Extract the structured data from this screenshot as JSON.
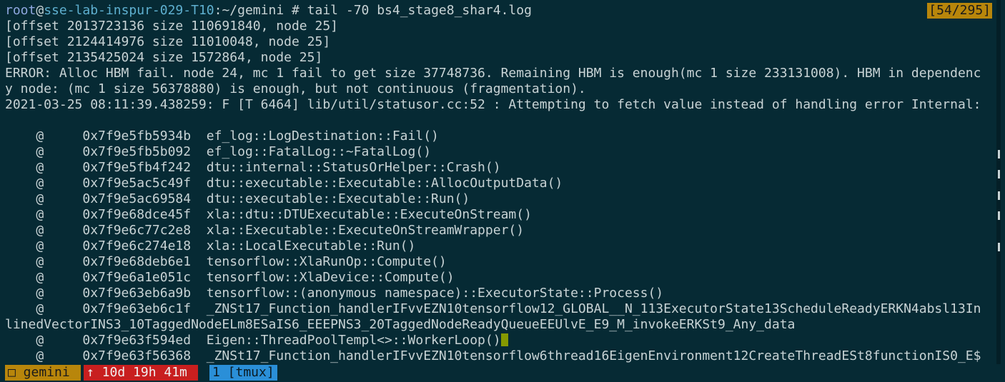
{
  "prompt": {
    "user": "root",
    "at": "@",
    "host": "sse-lab-inspur-029-T10",
    "path": ":~/gemini # ",
    "command": "tail -70 bs4_stage8_shar4.log"
  },
  "indicator": "[54/295]",
  "log_lines": [
    "[offset 2013723136 size 110691840, node 25]",
    "[offset 2124414976 size 11010048, node 25]",
    "[offset 2135425024 size 1572864, node 25]",
    "ERROR: Alloc HBM fail. node 24, mc 1 fail to get size 37748736. Remaining HBM is enough(mc 1 size 233131008). HBM in dependenc",
    "y node: (mc 1 size 56378880) is enough, but not continuous (fragmentation).",
    "2021-03-25 08:11:39.438259: F [T 6464] lib/util/statusor.cc:52 : Attempting to fetch value instead of handling error Internal:",
    "",
    "    @     0x7f9e5fb5934b  ef_log::LogDestination::Fail()",
    "    @     0x7f9e5fb5b092  ef_log::FatalLog::~FatalLog()",
    "    @     0x7f9e5fb4f242  dtu::internal::StatusOrHelper::Crash()",
    "    @     0x7f9e5ac5c49f  dtu::executable::Executable::AllocOutputData()",
    "    @     0x7f9e5ac69584  dtu::executable::Executable::Run()",
    "    @     0x7f9e68dce45f  xla::dtu::DTUExecutable::ExecuteOnStream()",
    "    @     0x7f9e6c77c2e8  xla::Executable::ExecuteOnStreamWrapper()",
    "    @     0x7f9e6c274e18  xla::LocalExecutable::Run()",
    "    @     0x7f9e68deb6e1  tensorflow::XlaRunOp::Compute()",
    "    @     0x7f9e6a1e051c  tensorflow::XlaDevice::Compute()",
    "    @     0x7f9e63eb6a9b  tensorflow::(anonymous namespace)::ExecutorState::Process()",
    "    @     0x7f9e63eb6c1f  _ZNSt17_Function_handlerIFvvEZN10tensorflow12_GLOBAL__N_113ExecutorState13ScheduleReadyERKN4absl13In",
    "linedVectorINS3_10TaggedNodeELm8ESaIS6_EEEPNS3_20TaggedNodeReadyQueueEEUlvE_E9_M_invokeERKSt9_Any_data",
    "    @     0x7f9e63f594ed  Eigen::ThreadPoolTempl<>::WorkerLoop()",
    "    @     0x7f9e63f56368  _ZNSt17_Function_handlerIFvvEZN10tensorflow6thread16EigenEnvironment12CreateThreadESt8functionIS0_E$"
  ],
  "status": {
    "session": "□ gemini ",
    "uptime": "↑ 10d 19h 41m ",
    "window": "1 [tmux]"
  },
  "colors": {
    "background": "#062a34",
    "indicator_bg": "#b8860b",
    "uptime_bg": "#c81f1f",
    "window_bg": "#2a8fd8",
    "cursor": "#859900"
  }
}
